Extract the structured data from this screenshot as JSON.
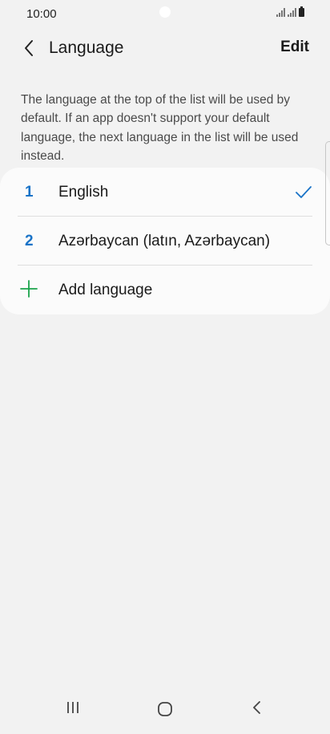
{
  "status_bar": {
    "time": "10:00"
  },
  "header": {
    "title": "Language",
    "edit_label": "Edit",
    "back_icon": "chevron-left-icon"
  },
  "description": "The language at the top of the list will be used by default. If an app doesn't support your default language, the next language in the list will be used instead.",
  "languages": [
    {
      "index": "1",
      "name": "English",
      "selected": true
    },
    {
      "index": "2",
      "name": "Azərbaycan (latın, Azərbaycan)",
      "selected": false
    }
  ],
  "add_language_label": "Add language",
  "colors": {
    "accent_blue": "#1a73c7",
    "add_green": "#1aa34a",
    "background": "#f2f2f2",
    "card": "#fbfbfb"
  },
  "nav_bar": {
    "icons": [
      "recent-apps-icon",
      "home-icon",
      "back-icon"
    ]
  }
}
